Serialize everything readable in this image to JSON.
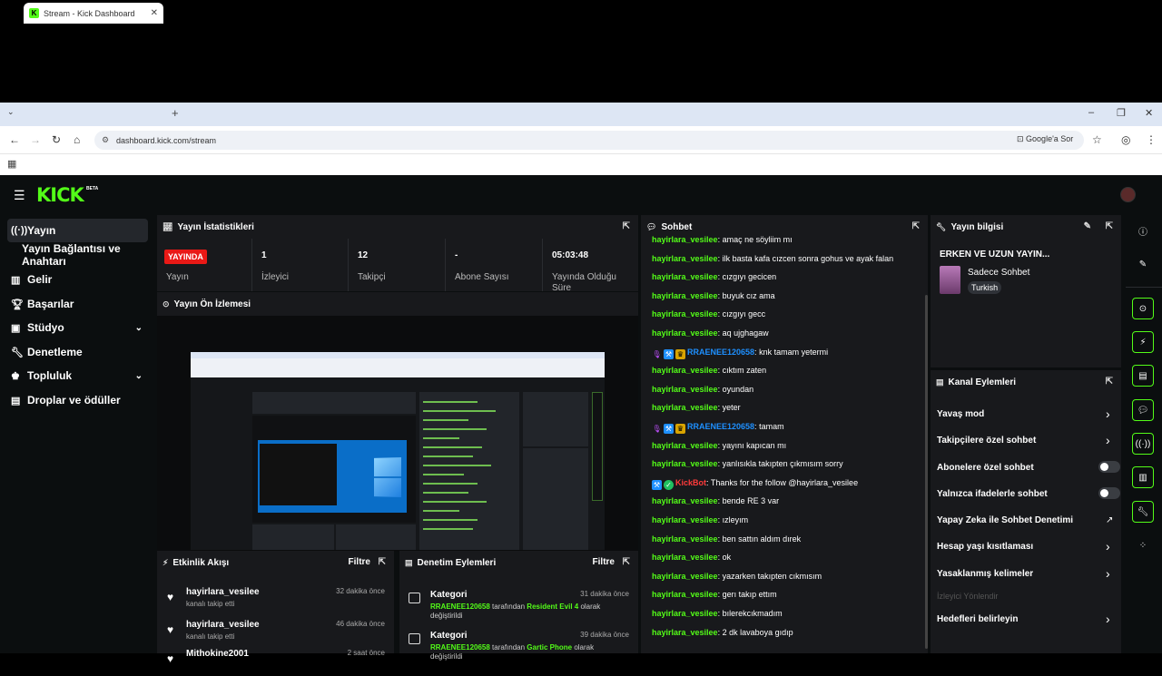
{
  "browser": {
    "tab_title": "Stream - Kick Dashboard",
    "url": "dashboard.kick.com/stream",
    "google_lens": "Google'a Sor"
  },
  "app": {
    "logo": "KICK",
    "beta": "BETA"
  },
  "sidebar": {
    "items": [
      {
        "label": "Yayın",
        "icon": "broadcast-icon"
      },
      {
        "label": "Yayın Bağlantısı ve Anahtarı"
      },
      {
        "label": "Gelir",
        "icon": "chart-icon"
      },
      {
        "label": "Başarılar",
        "icon": "trophy-icon"
      },
      {
        "label": "Stüdyo",
        "icon": "studio-icon"
      },
      {
        "label": "Denetleme",
        "icon": "wrench-icon"
      },
      {
        "label": "Topluluk",
        "icon": "community-icon"
      },
      {
        "label": "Droplar ve ödüller",
        "icon": "gift-icon"
      }
    ]
  },
  "stats": {
    "title": "Yayın İstatistikleri",
    "live_badge": "YAYINDA",
    "items": [
      {
        "value": "",
        "label": "Yayın"
      },
      {
        "value": "1",
        "label": "İzleyici"
      },
      {
        "value": "12",
        "label": "Takipçi"
      },
      {
        "value": "-",
        "label": "Abone Sayısı"
      },
      {
        "value": "05:03:48",
        "label": "Yayında Olduğu Süre"
      }
    ]
  },
  "preview": {
    "title": "Yayın Ön İzlemesi"
  },
  "activity": {
    "title": "Etkinlik Akışı",
    "filter": "Filtre",
    "items": [
      {
        "name": "hayirlara_vesilee",
        "sub": "kanalı takip etti",
        "time": "32 dakika önce"
      },
      {
        "name": "hayirlara_vesilee",
        "sub": "kanalı takip etti",
        "time": "46 dakika önce"
      },
      {
        "name": "Mithokine2001",
        "sub": "",
        "time": "2 saat önce"
      }
    ]
  },
  "moderation": {
    "title": "Denetim Eylemleri",
    "filter": "Filtre",
    "items": [
      {
        "title": "Kategori",
        "user": "RRAENEE120658",
        "mid": " tarafından ",
        "game": "Resident Evil 4",
        "tail": " olarak değiştirildi",
        "time": "31 dakika önce"
      },
      {
        "title": "Kategori",
        "user": "RRAENEE120658",
        "mid": " tarafından ",
        "game": "Gartic Phone",
        "tail": " olarak değiştirildi",
        "time": "39 dakika önce"
      }
    ]
  },
  "chat": {
    "title": "Sohbet",
    "messages": [
      {
        "user": "hayirlara_vesilee",
        "text": "amaç ne söyliim mı"
      },
      {
        "user": "hayirlara_vesilee",
        "text": "ilk basta kafa cızcen sonra gohus ve ayak falan"
      },
      {
        "user": "hayirlara_vesilee",
        "text": "cızgıyı gecicen"
      },
      {
        "user": "hayirlara_vesilee",
        "text": "buyuk cız ama"
      },
      {
        "user": "hayirlara_vesilee",
        "text": "cızgıyı gecc"
      },
      {
        "user": "hayirlara_vesilee",
        "text": "aq ujghagaw"
      },
      {
        "user": "RRAENEE120658",
        "text": "knk tamam yetermi",
        "badges": true,
        "color": "blue"
      },
      {
        "user": "hayirlara_vesilee",
        "text": "cıktım zaten"
      },
      {
        "user": "hayirlara_vesilee",
        "text": "oyundan"
      },
      {
        "user": "hayirlara_vesilee",
        "text": "yeter"
      },
      {
        "user": "RRAENEE120658",
        "text": "tamam",
        "badges": true,
        "color": "blue"
      },
      {
        "user": "hayirlara_vesilee",
        "text": "yayını kapıcan mı"
      },
      {
        "user": "hayirlara_vesilee",
        "text": "yanlısıkla takıpten çıkmısım sorry"
      },
      {
        "user": "KickBot",
        "text": "Thanks for the follow @hayirlara_vesilee",
        "bot": true,
        "color": "red"
      },
      {
        "user": "hayirlara_vesilee",
        "text": "bende RE 3 var"
      },
      {
        "user": "hayirlara_vesilee",
        "text": "ızleyım"
      },
      {
        "user": "hayirlara_vesilee",
        "text": "ben sattın aldım dırek"
      },
      {
        "user": "hayirlara_vesilee",
        "text": "ok"
      },
      {
        "user": "hayirlara_vesilee",
        "text": "yazarken takıpten cıkmısım"
      },
      {
        "user": "hayirlara_vesilee",
        "text": "gerı takıp ettım"
      },
      {
        "user": "hayirlara_vesilee",
        "text": "bılerekcıkmadım"
      },
      {
        "user": "hayirlara_vesilee",
        "text": "2 dk lavaboya gıdıp"
      }
    ]
  },
  "stream_info": {
    "title": "Yayın bilgisi",
    "stream_title": "ERKEN VE UZUN YAYIN...",
    "category": "Sadece Sohbet",
    "tag": "Turkish"
  },
  "channel_actions": {
    "title": "Kanal Eylemleri",
    "items": [
      {
        "label": "Yavaş mod",
        "type": "chevron"
      },
      {
        "label": "Takipçilere özel sohbet",
        "type": "chevron"
      },
      {
        "label": "Abonelere özel sohbet",
        "type": "toggle"
      },
      {
        "label": "Yalnızca ifadelerle sohbet",
        "type": "toggle"
      },
      {
        "label": "Yapay Zeka ile Sohbet Denetimi",
        "type": "external"
      },
      {
        "label": "Hesap yaşı kısıtlaması",
        "type": "chevron"
      },
      {
        "label": "Yasaklanmış kelimeler",
        "type": "chevron"
      }
    ],
    "section": "İzleyici Yönlendir",
    "target": "Hedefleri belirleyin"
  }
}
